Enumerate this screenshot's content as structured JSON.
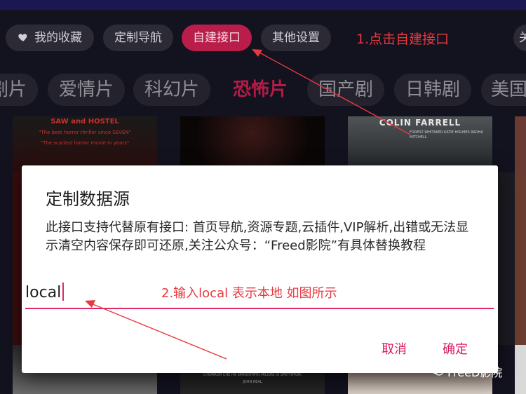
{
  "top_nav": {
    "favorites_label": "我的收藏",
    "custom_nav_label": "定制导航",
    "custom_api_label": "自建接口",
    "other_settings_label": "其他设置",
    "overflow_label": "关"
  },
  "genres": [
    "剧片",
    "爱情片",
    "科幻片",
    "恐怖片",
    "国产剧",
    "日韩剧",
    "美国"
  ],
  "active_genre": "恐怖片",
  "posters": {
    "poster1_line1": "SAW and HOSTEL",
    "poster1_line2": "\"The best horror thriller since SEVEN\"",
    "poster1_line3": "\"The scariest horror movie in years\"",
    "poster3_title": "COLIN FARRELL",
    "poster3_credits": "FOREST WHITAKER  KATIE HOLMES  RADHA MITCHELL",
    "bottom_poster_caption1": "L'HORROR CHE HA SPAVENTATO MILIONI DI SPETTATORI",
    "bottom_poster_caption2": "JOHN REAL"
  },
  "annotations": {
    "step1": "1.点击自建接口",
    "step2": "2.输入local 表示本地 如图所示"
  },
  "dialog": {
    "title": "定制数据源",
    "message": "此接口支持代替原有接口: 首页导航,资源专题,云插件,VIP解析,出错或无法显示清空内容保存即可还原,关注公众号：“Freed影院”有具体替换教程",
    "input_value": "local",
    "cancel_label": "取消",
    "ok_label": "确定"
  },
  "watermark": {
    "text": "FreeD影院"
  },
  "colors": {
    "accent": "#b91d4a",
    "dialog_accent": "#e02767",
    "annotation": "#e8383f",
    "background": "#13121f"
  }
}
